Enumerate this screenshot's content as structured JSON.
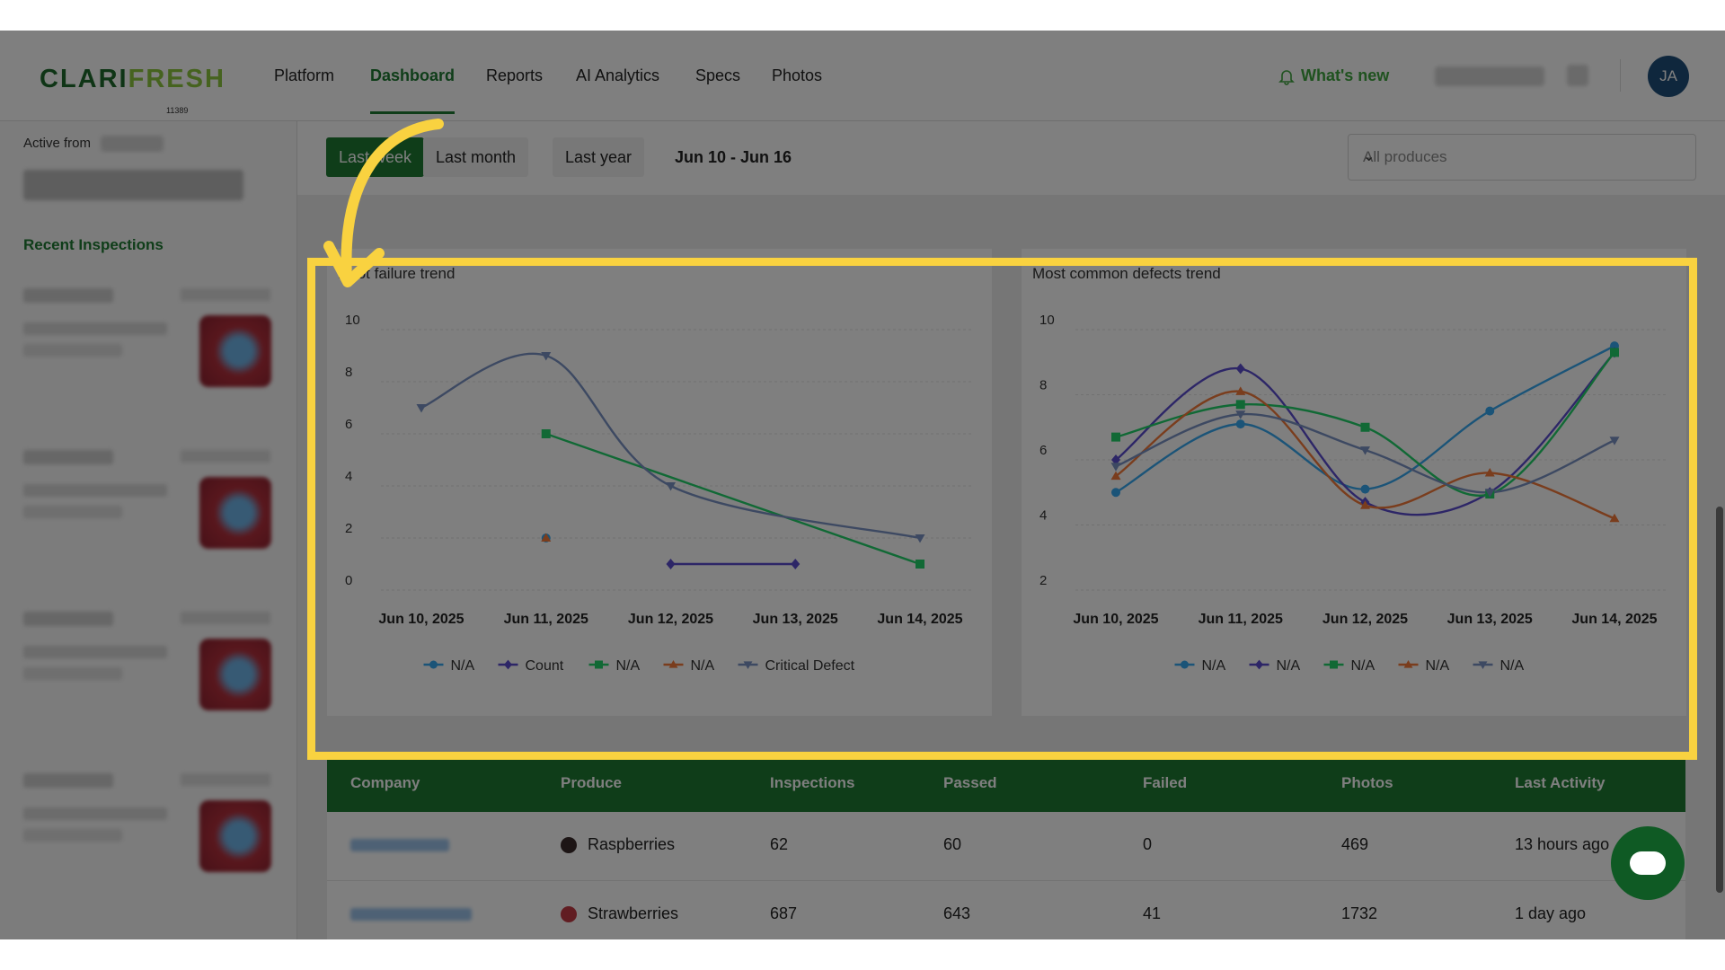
{
  "header": {
    "logo_part1": "CLARI",
    "logo_part2": "FRESH",
    "logo_sub": "11389",
    "nav": [
      "Platform",
      "Dashboard",
      "Reports",
      "AI Analytics",
      "Specs",
      "Photos"
    ],
    "active_nav": "Dashboard",
    "whats_new": "What's new",
    "avatar_initials": "JA"
  },
  "sidebar": {
    "active_from": "Active from",
    "recent_inspections": "Recent Inspections"
  },
  "filters": {
    "buttons": [
      "Last week",
      "Last month",
      "Last year"
    ],
    "active": "Last week",
    "date_range": "Jun 10 - Jun 16",
    "produce_placeholder": "All produces"
  },
  "colors": {
    "brand_green": "#1e7a32",
    "highlight": "#f9d240",
    "s1": "#37a8f0",
    "s2": "#5b4ccf",
    "s3": "#22d36b",
    "s4": "#f47a3a",
    "s5": "#7b93c5"
  },
  "chart_data": [
    {
      "type": "line",
      "title": "Root failure trend",
      "categories": [
        "Jun 10, 2025",
        "Jun 11, 2025",
        "Jun 12, 2025",
        "Jun 13, 2025",
        "Jun 14, 2025"
      ],
      "ylim": [
        0,
        10
      ],
      "yticks": [
        0,
        2,
        4,
        6,
        8,
        10
      ],
      "legend_position": "bottom",
      "series": [
        {
          "name": "N/A",
          "values": [
            null,
            2,
            null,
            null,
            null
          ],
          "color": "#37a8f0",
          "marker": "circle"
        },
        {
          "name": "Count",
          "values": [
            null,
            null,
            1,
            1,
            null
          ],
          "color": "#5b4ccf",
          "marker": "diamond"
        },
        {
          "name": "N/A",
          "values": [
            null,
            6,
            null,
            null,
            1
          ],
          "color": "#22d36b",
          "marker": "square"
        },
        {
          "name": "N/A",
          "values": [
            null,
            2,
            null,
            null,
            null
          ],
          "color": "#f47a3a",
          "marker": "triangle"
        },
        {
          "name": "Critical Defect",
          "values": [
            7,
            9,
            4,
            null,
            2
          ],
          "color": "#7b93c5",
          "marker": "triangle-down"
        }
      ]
    },
    {
      "type": "line",
      "title": "Most common defects trend",
      "categories": [
        "Jun 10, 2025",
        "Jun 11, 2025",
        "Jun 12, 2025",
        "Jun 13, 2025",
        "Jun 14, 2025"
      ],
      "ylim": [
        2,
        10
      ],
      "yticks": [
        2,
        4,
        6,
        8,
        10
      ],
      "legend_position": "bottom",
      "series": [
        {
          "name": "N/A",
          "values": [
            5,
            7.1,
            5.1,
            7.5,
            9.5
          ],
          "color": "#37a8f0",
          "marker": "circle"
        },
        {
          "name": "N/A",
          "values": [
            6,
            8.8,
            4.7,
            5,
            9.3
          ],
          "color": "#5b4ccf",
          "marker": "diamond"
        },
        {
          "name": "N/A",
          "values": [
            6.7,
            7.7,
            7,
            4.95,
            9.3
          ],
          "color": "#22d36b",
          "marker": "square"
        },
        {
          "name": "N/A",
          "values": [
            5.5,
            8.1,
            4.6,
            5.6,
            4.2
          ],
          "color": "#f47a3a",
          "marker": "triangle"
        },
        {
          "name": "N/A",
          "values": [
            5.8,
            7.4,
            6.3,
            5,
            6.6
          ],
          "color": "#7b93c5",
          "marker": "triangle-down"
        }
      ]
    }
  ],
  "table": {
    "headers": [
      "Company",
      "Produce",
      "Inspections",
      "Passed",
      "Failed",
      "Photos",
      "Last Activity"
    ],
    "rows": [
      {
        "produce": "Raspberries",
        "inspections": "62",
        "passed": "60",
        "failed": "0",
        "photos": "469",
        "last_activity": "13 hours ago"
      },
      {
        "produce": "Strawberries",
        "inspections": "687",
        "passed": "643",
        "failed": "41",
        "photos": "1732",
        "last_activity": "1 day ago"
      }
    ]
  }
}
